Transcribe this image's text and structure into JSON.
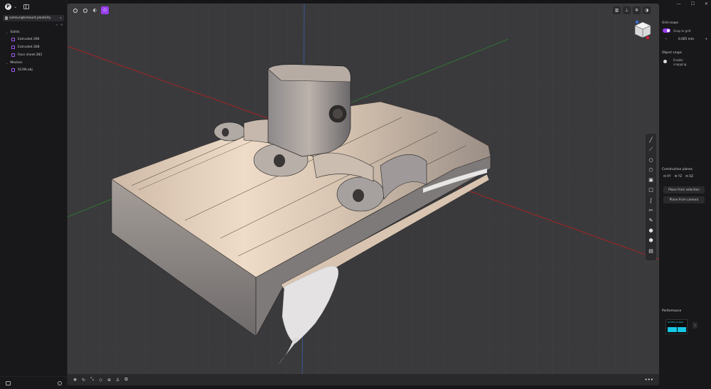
{
  "sidebar": {
    "file_tab": "samsungtvmount.plasticity",
    "tab_tools": "≡ · ⊕",
    "groups": [
      {
        "label": "Solids",
        "items": [
          "Extruded.396",
          "Extruded.368",
          "Face sheet.383"
        ]
      },
      {
        "label": "Meshes",
        "items": [
          "SCAN.obj"
        ]
      }
    ]
  },
  "right_panel": {
    "grid_snaps_title": "Grid snaps",
    "snap_to_grid_label": "Snap to grid",
    "snap_value": "0.005 mm",
    "minus_label": "−",
    "plus_label": "+",
    "object_snaps_title": "Object snaps",
    "enable_snapping_label_1": "Enable",
    "enable_snapping_label_2": "snapping",
    "construction_planes_title": "Construction planes",
    "planes": [
      "XY",
      "YZ",
      "XZ"
    ],
    "plane_from_selection_label": "Plane from selection",
    "plane_from_camera_label": "Plane from camera",
    "performance_title": "Performance",
    "performance_readout": "60 FPS (0-200)"
  },
  "viewport": {
    "more_label": "•••"
  },
  "colors": {
    "accent": "#9a3ff0",
    "viewport_bg": "#3a3a3d",
    "x_axis": "#b02020",
    "y_axis": "#2f7a2f",
    "z_axis": "#3a5fa8",
    "model_highlight": "#e8d6c4",
    "model_shadow": "#6d6d72",
    "perf_bar": "#16c8e6"
  },
  "icons": {
    "viewport_left": [
      "settings-icon",
      "info-icon",
      "shading-icon",
      "power-icon"
    ],
    "viewport_right": [
      "building-icon",
      "axes-icon",
      "gear-icon",
      "contrast-icon"
    ],
    "side_tools": [
      "line-icon",
      "curve-icon",
      "circle-icon",
      "hexagon-icon",
      "box-icon",
      "square-icon",
      "spline-icon",
      "scissors-icon",
      "pen-icon",
      "sphere-icon",
      "cube-icon",
      "cylinder-icon"
    ],
    "bottom_tools": [
      "move-icon",
      "rotate-icon",
      "scale-icon",
      "tag-icon",
      "group-icon",
      "hierarchy-icon",
      "duplicate-icon"
    ]
  }
}
